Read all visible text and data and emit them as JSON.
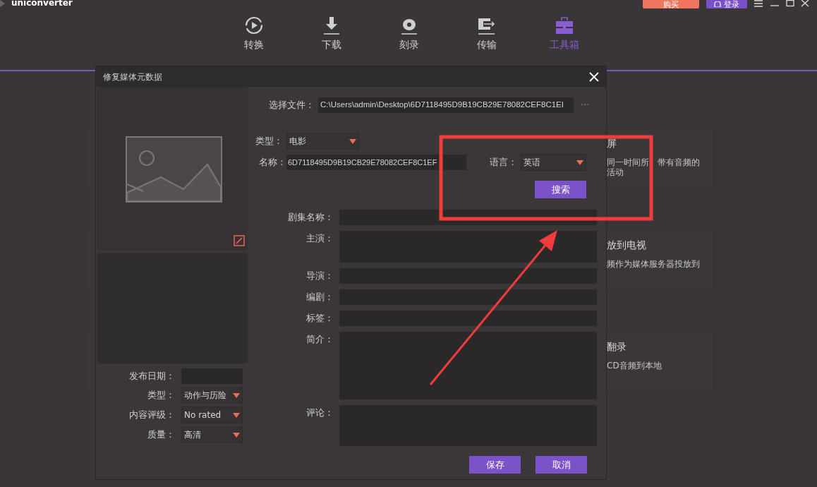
{
  "app": {
    "title": "uniconverter"
  },
  "header_buttons": [
    {
      "label": "购买",
      "kind": "buy"
    },
    {
      "label": "登录",
      "kind": "login"
    }
  ],
  "nav_tabs": [
    {
      "label": "转换",
      "kind": "convert",
      "selected": false
    },
    {
      "label": "下载",
      "kind": "download",
      "selected": false
    },
    {
      "label": "刻录",
      "kind": "burn",
      "selected": false
    },
    {
      "label": "传输",
      "kind": "transfer",
      "selected": false
    },
    {
      "label": "工具箱",
      "kind": "toolbox",
      "selected": true
    }
  ],
  "background_cards": [
    {
      "title": "屏",
      "description": [
        "同一时间所",
        "带有音频的",
        "活动"
      ]
    },
    {
      "title": "放到电视",
      "description": [
        "频作为媒体服务器投放到"
      ]
    },
    {
      "title": "翻录",
      "description": [
        "CD音频到本地"
      ]
    }
  ],
  "dialog": {
    "title": "修复媒体元数据",
    "file_label": "选择文件：",
    "file_path": "C:\\Users\\admin\\Desktop\\6D7118495D9B19CB29E78082CEF8C1EI",
    "browse": "···",
    "type_label": "类型：",
    "type_value": "电影",
    "name_label": "名称：",
    "name_value": "6D7118495D9B19CB29E78082CEF8C1EF",
    "language_label": "语言：",
    "language_value": "英语",
    "search_button": "搜索",
    "left_fields": [
      {
        "label": "发布日期：",
        "kind": "input"
      },
      {
        "label": "类型：",
        "kind": "dropdown",
        "value": "动作与历险"
      },
      {
        "label": "内容评级：",
        "kind": "dropdown",
        "value": "No rated"
      },
      {
        "label": "质量：",
        "kind": "dropdown",
        "value": "高清"
      }
    ],
    "fields": [
      {
        "label": "剧集名称：",
        "kind": "line"
      },
      {
        "label": "主演：",
        "kind": "short_area"
      },
      {
        "label": "导演：",
        "kind": "line"
      },
      {
        "label": "编剧：",
        "kind": "line"
      },
      {
        "label": "标签：",
        "kind": "line"
      },
      {
        "label": "简介：",
        "kind": "tall_area"
      },
      {
        "label": "评论：",
        "kind": "area"
      }
    ],
    "buttons": [
      {
        "label": "保存"
      },
      {
        "label": "取消"
      }
    ]
  }
}
